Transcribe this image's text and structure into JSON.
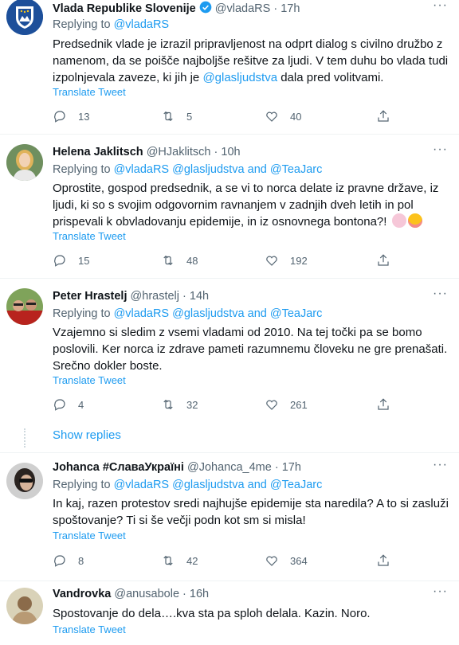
{
  "tweets": [
    {
      "name": "Vlada Republike Slovenije",
      "handle": "@vladaRS",
      "dot": "·",
      "time": "17h",
      "replying_prefix": "Replying to",
      "replying_to": [
        "@vladaRS"
      ],
      "replying_and": "",
      "text_part1": "Predsednik vlade je izrazil pripravljenost na odprt dialog s civilno družbo z namenom, da se poišče najboljše rešitve za ljudi. V tem duhu bo vlada tudi izpolnjevala zaveze, ki jih je ",
      "text_mention": "@glasljudstva",
      "text_part2": " dala pred volitvami.",
      "translate": "Translate Tweet",
      "replies": "13",
      "retweets": "5",
      "likes": "40"
    },
    {
      "name": "Helena Jaklitsch",
      "handle": "@HJaklitsch",
      "dot": "·",
      "time": "10h",
      "replying_prefix": "Replying to",
      "replying_to": [
        "@vladaRS",
        "@glasljudstva",
        "@TeaJarc"
      ],
      "replying_and": "and",
      "text": "Oprostite, gospod predsednik, a se vi to norca delate iz pravne države,  iz ljudi, ki so s svojim odgovornim ravnanjem v zadnjih dveh letih in pol prispevali k obvladovanju epidemije, in iz osnovnega bontona?!",
      "translate": "Translate Tweet",
      "replies": "15",
      "retweets": "48",
      "likes": "192"
    },
    {
      "name": "Peter Hrastelj",
      "handle": "@hrastelj",
      "dot": "·",
      "time": "14h",
      "replying_prefix": "Replying to",
      "replying_to": [
        "@vladaRS",
        "@glasljudstva",
        "@TeaJarc"
      ],
      "replying_and": "and",
      "text": "Vzajemno si sledim z vsemi vladami od 2010. Na tej točki pa se bomo poslovili. Ker norca iz zdrave pameti razumnemu človeku ne gre prenašati. Srečno dokler boste.",
      "translate": "Translate Tweet",
      "replies": "4",
      "retweets": "32",
      "likes": "261"
    },
    {
      "name": "Johanca #СлаваУкраїні",
      "handle": "@Johanca_4me",
      "dot": "·",
      "time": "17h",
      "replying_prefix": "Replying to",
      "replying_to": [
        "@vladaRS",
        "@glasljudstva",
        "@TeaJarc"
      ],
      "replying_and": "and",
      "text": "In kaj, razen protestov sredi najhujše epidemije sta naredila? A to si zasluži spoštovanje? Ti si še večji podn kot sm si misla!",
      "translate": "Translate Tweet",
      "replies": "8",
      "retweets": "42",
      "likes": "364"
    },
    {
      "name": "Vandrovka",
      "handle": "@anusabole",
      "dot": "·",
      "time": "16h",
      "text": "Spostovanje do dela….kva sta pa sploh delala. Kazin. Noro.",
      "translate": "Translate Tweet"
    }
  ],
  "show_replies": "Show replies",
  "colors": {
    "link": "#1d9bf0",
    "muted": "#536471",
    "text": "#0f1419",
    "divider": "#eff3f4"
  },
  "icons": [
    "reply-icon",
    "retweet-icon",
    "like-icon",
    "share-icon",
    "more-icon",
    "verified-badge-icon"
  ]
}
